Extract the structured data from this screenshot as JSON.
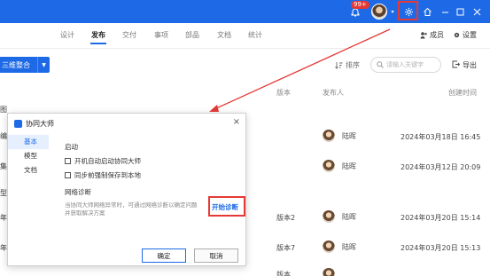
{
  "titlebar": {
    "badge": "99+",
    "icons": [
      "bell-icon",
      "avatar",
      "gear-icon",
      "home-icon",
      "minimize-icon",
      "maximize-icon",
      "close-icon"
    ]
  },
  "tabs": [
    "设计",
    "发布",
    "交付",
    "事项",
    "部品",
    "文档",
    "统计"
  ],
  "active_tab": "发布",
  "header_right": {
    "members": "成员",
    "settings": "设置"
  },
  "toolbar": {
    "dropdown_label": "三维整合",
    "sort_label": "排序",
    "search_placeholder": "请输入关键字",
    "export_label": "导出"
  },
  "table": {
    "columns": {
      "version": "版本",
      "publisher": "发布人",
      "created": "创建时间"
    },
    "rows": [
      {
        "version": "",
        "publisher": "陆晖",
        "created": "2024年03月18日 16:45"
      },
      {
        "version": "",
        "publisher": "陆晖",
        "created": "2024年03月12日 20:09"
      },
      {
        "version": "版本2",
        "publisher": "陆晖",
        "created": "2024年03月20日 15:14"
      },
      {
        "version": "版本7",
        "publisher": "陆晖",
        "created": "2024年03月20日 15:13"
      },
      {
        "version": "版本",
        "publisher": "",
        "created": ""
      }
    ],
    "left_fragments": [
      "图",
      "编",
      "集",
      "型",
      "年-",
      "年-"
    ]
  },
  "dialog": {
    "title": "协同大师",
    "close": "×",
    "nav": [
      "基本",
      "模型",
      "文档"
    ],
    "startup_title": "启动",
    "checkbox_1": "开机自动启动协同大师",
    "checkbox_2": "同步前强制保存到本地",
    "network_title": "网络诊断",
    "network_desc": "当协同大师网络异常时，可通过网络诊断以确定问题并获取解决方案",
    "diagnose_button": "开始诊断",
    "ok_button": "确定",
    "cancel_button": "取消"
  },
  "colors": {
    "brand": "#1e6ae6",
    "highlight": "#e53935"
  }
}
